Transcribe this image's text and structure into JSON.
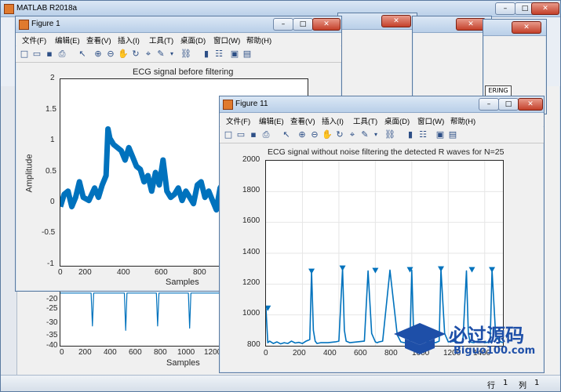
{
  "main_window": {
    "title": "MATLAB R2018a"
  },
  "bg_figures": {
    "partial_label": "ERING"
  },
  "status_bar": {
    "row_label": "行",
    "row_value": "1",
    "col_label": "列",
    "col_value": "1"
  },
  "figure1": {
    "title": "Figure 1",
    "menu": [
      "文件(F)",
      "编辑(E)",
      "查看(V)",
      "插入(I)",
      "工具(T)",
      "桌面(D)",
      "窗口(W)",
      "帮助(H)"
    ]
  },
  "figure11": {
    "title": "Figure 11",
    "menu": [
      "文件(F)",
      "编辑(E)",
      "查看(V)",
      "插入(I)",
      "工具(T)",
      "桌面(D)",
      "窗口(W)",
      "帮助(H)"
    ]
  },
  "watermark": {
    "brand": "必过源码",
    "url": "Biguo100.com"
  },
  "chart_data": [
    {
      "type": "line",
      "title": "ECG signal before filtering",
      "xlabel": "Samples",
      "ylabel": "Amplitude",
      "xlim": [
        0,
        1300
      ],
      "ylim": [
        -1,
        2
      ],
      "xticks": [
        "0",
        "200",
        "400",
        "600",
        "800",
        "1000",
        "1200"
      ],
      "yticks": [
        "-1",
        "-0.5",
        "0",
        "0.5",
        "1",
        "1.5",
        "2"
      ],
      "grid": false,
      "series": [
        {
          "color": "#0072bd",
          "x": [
            0,
            20,
            40,
            60,
            80,
            100,
            120,
            150,
            180,
            200,
            220,
            240,
            250,
            260,
            280,
            300,
            320,
            340,
            360,
            380,
            400,
            420,
            440,
            460,
            480,
            500,
            520,
            540,
            560,
            580,
            600,
            620,
            640,
            660,
            680,
            700,
            720,
            740,
            760,
            780,
            800,
            820,
            840,
            860,
            880,
            900,
            920,
            940,
            960,
            980,
            1000,
            1020,
            1040,
            1060,
            1080,
            1100,
            1120,
            1140,
            1160,
            1180,
            1200,
            1220,
            1240,
            1260,
            1280,
            1300
          ],
          "y": [
            -0.05,
            0.15,
            0.2,
            -0.05,
            0.1,
            0.35,
            0.1,
            0.05,
            0.25,
            0.1,
            0.3,
            0.45,
            1.2,
            1.05,
            0.95,
            0.9,
            0.85,
            0.7,
            0.9,
            0.75,
            0.6,
            0.55,
            0.35,
            0.45,
            0.2,
            0.5,
            0.3,
            0.7,
            0.2,
            0.1,
            0.15,
            0.25,
            0.05,
            0.2,
            0.1,
            0.0,
            0.3,
            0.35,
            0.1,
            0.2,
            0.05,
            -0.1,
            0.25,
            0.35,
            0.2,
            0.15,
            -0.1,
            0.1,
            0.3,
            0.35,
            0.05,
            0.25,
            0.35,
            0.05,
            0.15,
            0.2,
            0.25,
            0.4,
            0.1,
            0.05,
            0.35,
            0.4,
            0.2,
            0.1,
            0.15,
            0.1
          ]
        }
      ]
    },
    {
      "type": "line",
      "title": "ECG signal without noise filtering the detected R waves for N=25",
      "xlabel": "",
      "ylabel": "",
      "xlim": [
        0,
        1300
      ],
      "ylim": [
        800,
        2000
      ],
      "xticks": [
        "0",
        "200",
        "400",
        "600",
        "800",
        "1000",
        "1200",
        "1400"
      ],
      "yticks": [
        "800",
        "1000",
        "1200",
        "1400",
        "1600",
        "1800",
        "2000"
      ],
      "grid": true,
      "series": [
        {
          "color": "#0072bd",
          "x": [
            0,
            10,
            20,
            40,
            60,
            80,
            100,
            120,
            140,
            160,
            180,
            200,
            220,
            240,
            250,
            260,
            270,
            280,
            300,
            340,
            380,
            400,
            420,
            430,
            440,
            460,
            500,
            540,
            560,
            580,
            600,
            610,
            620,
            640,
            680,
            720,
            740,
            760,
            790,
            800,
            810,
            830,
            860,
            900,
            930,
            950,
            960,
            980,
            1000,
            1040,
            1060,
            1080,
            1100,
            1110,
            1120,
            1140,
            1160,
            1180,
            1200,
            1230,
            1240,
            1260,
            1280,
            1300
          ],
          "y": [
            1040,
            820,
            830,
            815,
            825,
            812,
            820,
            815,
            830,
            818,
            822,
            815,
            830,
            840,
            1280,
            900,
            830,
            815,
            820,
            820,
            825,
            830,
            1300,
            900,
            830,
            820,
            825,
            830,
            1285,
            880,
            825,
            820,
            825,
            830,
            1290,
            870,
            825,
            820,
            830,
            1290,
            880,
            825,
            830,
            825,
            820,
            830,
            1295,
            880,
            825,
            830,
            820,
            825,
            1285,
            880,
            825,
            820,
            830,
            825,
            820,
            825,
            1290,
            870,
            830,
            820
          ]
        }
      ],
      "markers": {
        "x": [
          10,
          250,
          420,
          600,
          790,
          960,
          1130,
          1240
        ],
        "y": [
          1040,
          1280,
          1300,
          1285,
          1290,
          1295,
          1290,
          1290
        ]
      }
    },
    {
      "type": "line",
      "title": "",
      "xlabel": "Samples",
      "ylabel": "",
      "xlim": [
        0,
        1300
      ],
      "ylim": [
        -40,
        -15
      ],
      "xticks": [
        "0",
        "200",
        "400",
        "600",
        "800",
        "1000",
        "1200"
      ],
      "yticks": [
        "-20",
        "-25",
        "-30",
        "-35",
        "-40"
      ],
      "grid": false,
      "series": [
        {
          "color": "#0072bd",
          "x": [
            0,
            240,
            250,
            260,
            500,
            510,
            520,
            750,
            760,
            770,
            1000,
            1010,
            1020,
            1300
          ],
          "y": [
            -16,
            -16,
            -31,
            -16,
            -16,
            -33,
            -16,
            -16,
            -31,
            -16,
            -16,
            -32,
            -16,
            -16
          ]
        }
      ]
    }
  ]
}
